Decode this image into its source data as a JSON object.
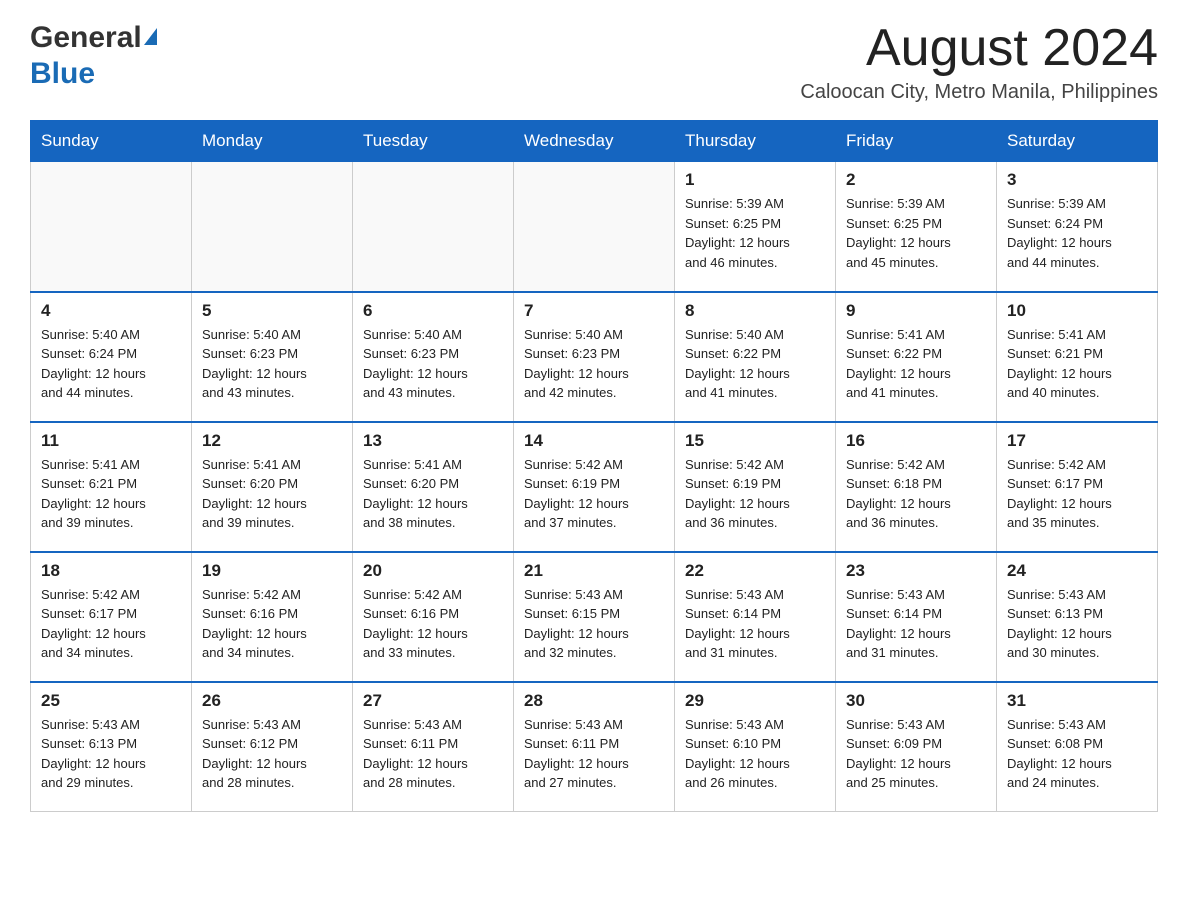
{
  "header": {
    "logo_general": "General",
    "logo_blue": "Blue",
    "month_title": "August 2024",
    "location": "Caloocan City, Metro Manila, Philippines"
  },
  "days_of_week": [
    "Sunday",
    "Monday",
    "Tuesday",
    "Wednesday",
    "Thursday",
    "Friday",
    "Saturday"
  ],
  "weeks": [
    [
      {
        "day": "",
        "info": ""
      },
      {
        "day": "",
        "info": ""
      },
      {
        "day": "",
        "info": ""
      },
      {
        "day": "",
        "info": ""
      },
      {
        "day": "1",
        "info": "Sunrise: 5:39 AM\nSunset: 6:25 PM\nDaylight: 12 hours\nand 46 minutes."
      },
      {
        "day": "2",
        "info": "Sunrise: 5:39 AM\nSunset: 6:25 PM\nDaylight: 12 hours\nand 45 minutes."
      },
      {
        "day": "3",
        "info": "Sunrise: 5:39 AM\nSunset: 6:24 PM\nDaylight: 12 hours\nand 44 minutes."
      }
    ],
    [
      {
        "day": "4",
        "info": "Sunrise: 5:40 AM\nSunset: 6:24 PM\nDaylight: 12 hours\nand 44 minutes."
      },
      {
        "day": "5",
        "info": "Sunrise: 5:40 AM\nSunset: 6:23 PM\nDaylight: 12 hours\nand 43 minutes."
      },
      {
        "day": "6",
        "info": "Sunrise: 5:40 AM\nSunset: 6:23 PM\nDaylight: 12 hours\nand 43 minutes."
      },
      {
        "day": "7",
        "info": "Sunrise: 5:40 AM\nSunset: 6:23 PM\nDaylight: 12 hours\nand 42 minutes."
      },
      {
        "day": "8",
        "info": "Sunrise: 5:40 AM\nSunset: 6:22 PM\nDaylight: 12 hours\nand 41 minutes."
      },
      {
        "day": "9",
        "info": "Sunrise: 5:41 AM\nSunset: 6:22 PM\nDaylight: 12 hours\nand 41 minutes."
      },
      {
        "day": "10",
        "info": "Sunrise: 5:41 AM\nSunset: 6:21 PM\nDaylight: 12 hours\nand 40 minutes."
      }
    ],
    [
      {
        "day": "11",
        "info": "Sunrise: 5:41 AM\nSunset: 6:21 PM\nDaylight: 12 hours\nand 39 minutes."
      },
      {
        "day": "12",
        "info": "Sunrise: 5:41 AM\nSunset: 6:20 PM\nDaylight: 12 hours\nand 39 minutes."
      },
      {
        "day": "13",
        "info": "Sunrise: 5:41 AM\nSunset: 6:20 PM\nDaylight: 12 hours\nand 38 minutes."
      },
      {
        "day": "14",
        "info": "Sunrise: 5:42 AM\nSunset: 6:19 PM\nDaylight: 12 hours\nand 37 minutes."
      },
      {
        "day": "15",
        "info": "Sunrise: 5:42 AM\nSunset: 6:19 PM\nDaylight: 12 hours\nand 36 minutes."
      },
      {
        "day": "16",
        "info": "Sunrise: 5:42 AM\nSunset: 6:18 PM\nDaylight: 12 hours\nand 36 minutes."
      },
      {
        "day": "17",
        "info": "Sunrise: 5:42 AM\nSunset: 6:17 PM\nDaylight: 12 hours\nand 35 minutes."
      }
    ],
    [
      {
        "day": "18",
        "info": "Sunrise: 5:42 AM\nSunset: 6:17 PM\nDaylight: 12 hours\nand 34 minutes."
      },
      {
        "day": "19",
        "info": "Sunrise: 5:42 AM\nSunset: 6:16 PM\nDaylight: 12 hours\nand 34 minutes."
      },
      {
        "day": "20",
        "info": "Sunrise: 5:42 AM\nSunset: 6:16 PM\nDaylight: 12 hours\nand 33 minutes."
      },
      {
        "day": "21",
        "info": "Sunrise: 5:43 AM\nSunset: 6:15 PM\nDaylight: 12 hours\nand 32 minutes."
      },
      {
        "day": "22",
        "info": "Sunrise: 5:43 AM\nSunset: 6:14 PM\nDaylight: 12 hours\nand 31 minutes."
      },
      {
        "day": "23",
        "info": "Sunrise: 5:43 AM\nSunset: 6:14 PM\nDaylight: 12 hours\nand 31 minutes."
      },
      {
        "day": "24",
        "info": "Sunrise: 5:43 AM\nSunset: 6:13 PM\nDaylight: 12 hours\nand 30 minutes."
      }
    ],
    [
      {
        "day": "25",
        "info": "Sunrise: 5:43 AM\nSunset: 6:13 PM\nDaylight: 12 hours\nand 29 minutes."
      },
      {
        "day": "26",
        "info": "Sunrise: 5:43 AM\nSunset: 6:12 PM\nDaylight: 12 hours\nand 28 minutes."
      },
      {
        "day": "27",
        "info": "Sunrise: 5:43 AM\nSunset: 6:11 PM\nDaylight: 12 hours\nand 28 minutes."
      },
      {
        "day": "28",
        "info": "Sunrise: 5:43 AM\nSunset: 6:11 PM\nDaylight: 12 hours\nand 27 minutes."
      },
      {
        "day": "29",
        "info": "Sunrise: 5:43 AM\nSunset: 6:10 PM\nDaylight: 12 hours\nand 26 minutes."
      },
      {
        "day": "30",
        "info": "Sunrise: 5:43 AM\nSunset: 6:09 PM\nDaylight: 12 hours\nand 25 minutes."
      },
      {
        "day": "31",
        "info": "Sunrise: 5:43 AM\nSunset: 6:08 PM\nDaylight: 12 hours\nand 24 minutes."
      }
    ]
  ]
}
